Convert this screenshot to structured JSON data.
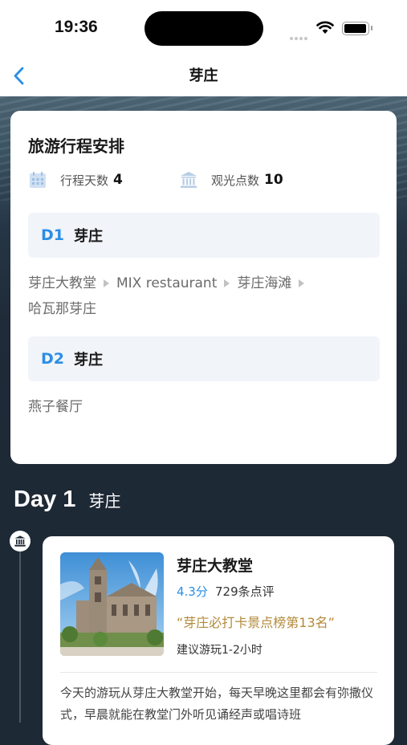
{
  "status_bar": {
    "time": "19:36"
  },
  "nav": {
    "title": "芽庄"
  },
  "itinerary": {
    "title": "旅游行程安排",
    "days_label": "行程天数",
    "days_value": "4",
    "spots_label": "观光点数",
    "spots_value": "10",
    "days": [
      {
        "code": "D1",
        "city": "芽庄",
        "stops": [
          "芽庄大教堂",
          "MIX restaurant",
          "芽庄海滩",
          "哈瓦那芽庄"
        ]
      },
      {
        "code": "D2",
        "city": "芽庄",
        "stops": [
          "燕子餐厅"
        ]
      }
    ]
  },
  "day_section": {
    "label": "Day 1",
    "city": "芽庄"
  },
  "poi": {
    "name": "芽庄大教堂",
    "rating": "4.3分",
    "reviews": "729条点评",
    "rank": "“芽庄必打卡景点榜第13名”",
    "duration": "建议游玩1-2小时",
    "description": "今天的游玩从芽庄大教堂开始，每天早晚这里都会有弥撒仪式，早晨就能在教堂门外听见诵经声或唱诗班"
  },
  "icons": [
    "back-chevron-icon",
    "wifi-icon",
    "battery-icon",
    "calendar-icon",
    "landmark-icon"
  ],
  "colors": {
    "accent": "#2b8ee6",
    "rank_gold": "#b38a3a",
    "page_dark": "#1e2936"
  }
}
